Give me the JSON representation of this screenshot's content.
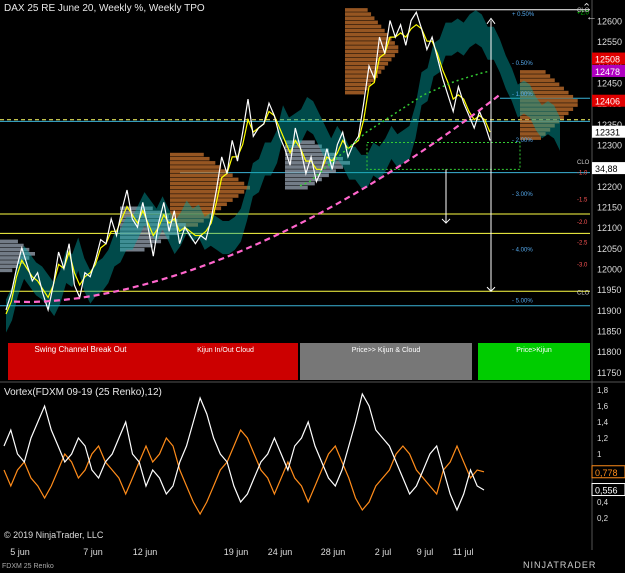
{
  "header": {
    "title": "DAX 25 RE June 20, Weekly %, Weekly TPO"
  },
  "vortex_title": "Vortex(FDXM 09-19 (25 Renko),12)",
  "copyright": "© 2019 NinjaTrader, LLC",
  "instrument": "FDXM 25 Renko",
  "brand": "NINJATRADER",
  "icons": {
    "up": "chevron-up-icon",
    "back": "arrow-left-icon",
    "logo": "ninjatrader-logo-icon"
  },
  "colors": {
    "background": "#000000",
    "price": "#ffffff",
    "signal": "#ffff00",
    "cloud": "#00a5a5",
    "tpo": "#c8732d",
    "tpo_light": "#9aa6b4",
    "sma": "#ff66cc",
    "vortex_plus": "#ff8c1a",
    "vortex_minus": "#ffffff",
    "box_red": "#cc0000",
    "box_gray": "#777777",
    "box_green": "#00cc00"
  },
  "chart_data": [
    {
      "type": "line",
      "title": "DAX 25 RE June 20, Weekly %, Weekly TPO",
      "ylim": [
        11740,
        12640
      ],
      "y_ticks": [
        11750,
        11800,
        11850,
        11900,
        11950,
        12000,
        12050,
        12100,
        12150,
        12200,
        12250,
        12300,
        12350,
        12400,
        12450,
        12500,
        12550,
        12600
      ],
      "x_tick_labels": [
        "5 jun",
        "7 jun",
        "12 jun",
        "19 jun",
        "24 jun",
        "28 jun",
        "2 jul",
        "9 jul",
        "11 jul"
      ],
      "price_tags": [
        {
          "label": "12508",
          "value": 12508,
          "color": "#e00000"
        },
        {
          "label": "12478",
          "value": 12478,
          "color": "#b000c0"
        },
        {
          "label": "12406",
          "value": 12406,
          "color": "#e00000"
        },
        {
          "label": "12331",
          "value": 12331,
          "color": "#ffffff"
        },
        {
          "label": "34,88",
          "value": 12243,
          "color": "#ffffff"
        }
      ],
      "percent_levels": [
        {
          "label": "+ 0.50%",
          "value": 12618
        },
        {
          "label": "- 0.50%",
          "value": 12500
        },
        {
          "label": "- 1.00%",
          "value": 12425
        },
        {
          "label": "- 2.00%",
          "value": 12313
        },
        {
          "label": "- 3.00%",
          "value": 12183
        },
        {
          "label": "- 4.00%",
          "value": 12048
        },
        {
          "label": "- 5.00%",
          "value": 11925
        }
      ],
      "small_levels": [
        {
          "label": "+2.0",
          "value": 12622,
          "color": "#00cc00"
        },
        {
          "label": "-1.0",
          "value": 12235,
          "color": "#ff5555"
        },
        {
          "label": "-1.5",
          "value": 12170,
          "color": "#ff5555"
        },
        {
          "label": "-2.0",
          "value": 12115,
          "color": "#ff5555"
        },
        {
          "label": "-2.5",
          "value": 12065,
          "color": "#ff5555"
        },
        {
          "label": "-3.0",
          "value": 12012,
          "color": "#ff5555"
        },
        {
          "label": "CLO",
          "value": 12628,
          "color": "#cccccc"
        },
        {
          "label": "CLO",
          "value": 12260,
          "color": "#cccccc"
        },
        {
          "label": "CLO",
          "value": 11945,
          "color": "#cccccc"
        }
      ],
      "signal_boxes": [
        {
          "label": "Swing Channel Break Out",
          "color": "#cc0000"
        },
        {
          "label": "Kijun In/Out Cloud",
          "color": "#cc0000"
        },
        {
          "label": "Price>> Kijun & Cloud",
          "color": "#777777"
        },
        {
          "label": "Price>Kijun",
          "color": "#00cc00"
        }
      ],
      "series": [
        {
          "values": [
            11900,
            11940,
            12000,
            12050,
            12010,
            11970,
            11990,
            11940,
            11900,
            11960,
            12040,
            12000,
            12060,
            11960,
            11930,
            11990,
            11980,
            12020,
            12070,
            12060,
            12120,
            12080,
            12140,
            12190,
            12120,
            12100,
            12160,
            12100,
            12030,
            12110,
            12160,
            12090,
            12140,
            12060,
            12100,
            12080,
            12060,
            12080,
            12070,
            12120,
            12190,
            12270,
            12230,
            12310,
            12260,
            12330,
            12410,
            12320,
            12340,
            12350,
            12400,
            12370,
            12320,
            12290,
            12250,
            12340,
            12290,
            12230,
            12270,
            12210,
            12240,
            12290,
            12240,
            12300,
            12330,
            12270,
            12300,
            12320,
            12400,
            12490,
            12460,
            12560,
            12520,
            12600,
            12560,
            12590,
            12540,
            12600,
            12620,
            12580,
            12530,
            12560,
            12510,
            12460,
            12420,
            12380,
            12440,
            12400,
            12370,
            12340,
            12380,
            12350,
            12310
          ]
        },
        {
          "values": [
            11890,
            11920,
            11980,
            12020,
            12000,
            11980,
            11970,
            11950,
            11930,
            11960,
            12010,
            12000,
            12040,
            11990,
            11960,
            11980,
            11990,
            12010,
            12050,
            12060,
            12090,
            12090,
            12120,
            12150,
            12130,
            12110,
            12140,
            12110,
            12080,
            12100,
            12130,
            12110,
            12120,
            12090,
            12100,
            12090,
            12080,
            12080,
            12090,
            12110,
            12160,
            12220,
            12230,
            12270,
            12270,
            12300,
            12360,
            12330,
            12340,
            12350,
            12380,
            12370,
            12340,
            12310,
            12280,
            12310,
            12290,
            12260,
            12260,
            12240,
            12240,
            12270,
            12260,
            12280,
            12310,
            12290,
            12300,
            12310,
            12360,
            12440,
            12450,
            12510,
            12520,
            12560,
            12560,
            12570,
            12560,
            12580,
            12590,
            12580,
            12550,
            12550,
            12520,
            12480,
            12450,
            12410,
            12420,
            12410,
            12380,
            12360,
            12370,
            12360,
            12330
          ]
        },
        {
          "values": [
            12200,
            12210,
            12230,
            12250,
            12270,
            12290,
            12310,
            12330,
            12345,
            12360,
            12375,
            12390,
            12405,
            12420,
            12430,
            12440,
            12450,
            12458,
            12465,
            12472,
            12478
          ]
        }
      ]
    },
    {
      "type": "line",
      "title": "Vortex(FDXM 09-19 (25 Renko),12)",
      "ylim": [
        0.05,
        1.85
      ],
      "y_ticks": [
        0.2,
        0.4,
        0.6,
        0.8,
        1.0,
        1.2,
        1.4,
        1.6,
        1.8
      ],
      "y_tick_labels": [
        "0,2",
        "0,4",
        "0,6",
        "0,8",
        "1",
        "1,2",
        "1,4",
        "1,6",
        "1,8"
      ],
      "value_tags": [
        {
          "label": "0,778",
          "value": 0.778,
          "color": "#ff8c1a"
        },
        {
          "label": "0,556",
          "value": 0.556,
          "color": "#ffffff"
        }
      ],
      "series": [
        {
          "values": [
            1.1,
            1.3,
            1.0,
            0.9,
            1.2,
            1.4,
            1.6,
            1.3,
            1.1,
            0.9,
            1.0,
            1.2,
            1.1,
            0.8,
            0.7,
            0.9,
            1.0,
            1.2,
            1.4,
            1.0,
            0.9,
            0.6,
            0.8,
            0.7,
            0.5,
            0.6,
            0.9,
            1.1,
            1.4,
            1.7,
            1.5,
            1.2,
            1.0,
            0.9,
            0.6,
            0.4,
            0.5,
            0.7,
            0.9,
            1.0,
            1.2,
            1.0,
            0.8,
            1.1,
            1.2,
            1.4,
            1.1,
            0.9,
            0.7,
            0.6,
            0.8,
            1.1,
            1.4,
            1.75,
            1.6,
            1.3,
            1.2,
            1.1,
            0.9,
            0.7,
            0.5,
            0.6,
            0.8,
            1.0,
            1.1,
            0.8,
            0.5,
            0.3,
            0.5,
            0.8,
            0.6,
            0.55
          ]
        },
        {
          "values": [
            0.8,
            0.6,
            0.8,
            0.9,
            0.7,
            0.6,
            0.45,
            0.6,
            0.8,
            1.0,
            0.9,
            0.7,
            0.8,
            1.0,
            1.1,
            0.9,
            0.8,
            0.7,
            0.5,
            0.7,
            0.9,
            1.1,
            0.9,
            1.0,
            1.2,
            1.1,
            0.8,
            0.6,
            0.4,
            0.25,
            0.4,
            0.6,
            0.8,
            0.9,
            1.1,
            1.3,
            1.2,
            1.0,
            0.8,
            0.7,
            0.5,
            0.7,
            0.9,
            0.7,
            0.6,
            0.4,
            0.6,
            0.8,
            1.0,
            1.1,
            0.9,
            0.7,
            0.45,
            0.3,
            0.4,
            0.6,
            0.7,
            0.8,
            1.0,
            1.1,
            1.0,
            0.8,
            0.7,
            0.6,
            0.5,
            0.8,
            0.9,
            1.1,
            0.9,
            0.7,
            0.8,
            0.778
          ]
        }
      ]
    }
  ]
}
